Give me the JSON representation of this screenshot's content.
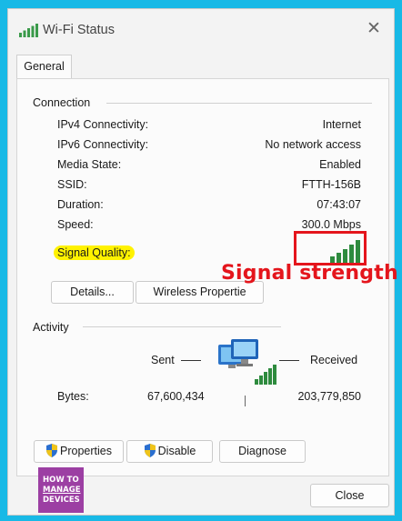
{
  "window": {
    "title": "Wi-Fi Status"
  },
  "tabs": [
    {
      "label": "General"
    }
  ],
  "connection": {
    "title": "Connection",
    "rows": [
      {
        "label": "IPv4 Connectivity:",
        "value": "Internet"
      },
      {
        "label": "IPv6 Connectivity:",
        "value": "No network access"
      },
      {
        "label": "Media State:",
        "value": "Enabled"
      },
      {
        "label": "SSID:",
        "value": "FTTH-156B"
      },
      {
        "label": "Duration:",
        "value": "07:43:07"
      },
      {
        "label": "Speed:",
        "value": "300.0 Mbps"
      }
    ],
    "signal_label": "Signal Quality:",
    "signal_bars": 5,
    "signal_bars_filled": 5,
    "details_button": "Details...",
    "wireless_button": "Wireless Propertie"
  },
  "annotation": {
    "text": "Signal strength",
    "color": "#e4151c",
    "highlight": "#fff200"
  },
  "activity": {
    "title": "Activity",
    "sent_label": "Sent",
    "received_label": "Received",
    "bytes_label": "Bytes:",
    "bytes_sent": "67,600,434",
    "bytes_received": "203,779,850"
  },
  "buttons": {
    "properties": "Properties",
    "disable": "Disable",
    "diagnose": "Diagnose",
    "close": "Close"
  },
  "logo": {
    "line1": "HOW TO",
    "line2": "MANAGE",
    "line3": "DEVICES"
  },
  "colors": {
    "background": "#18b9e6",
    "signal_green": "#2e8b3e"
  }
}
